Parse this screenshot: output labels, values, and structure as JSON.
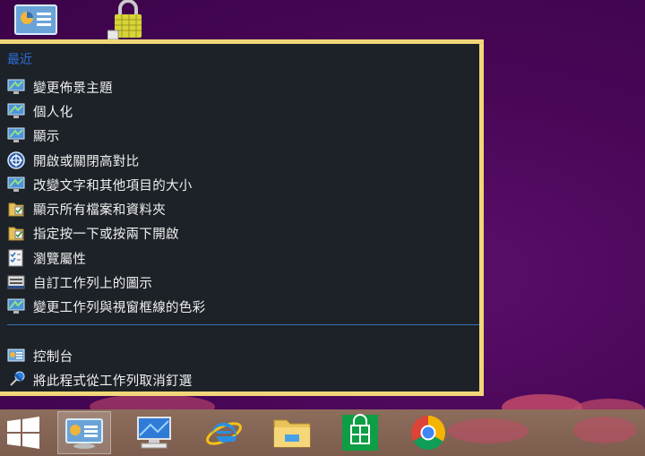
{
  "jumplist": {
    "recent_header": "最近",
    "recent_items": [
      {
        "label": "變更佈景主題",
        "icon": "monitor-icon"
      },
      {
        "label": "個人化",
        "icon": "monitor-icon"
      },
      {
        "label": "顯示",
        "icon": "monitor-icon"
      },
      {
        "label": "開啟或關閉高對比",
        "icon": "accessibility-icon"
      },
      {
        "label": "改變文字和其他項目的大小",
        "icon": "monitor-icon"
      },
      {
        "label": "顯示所有檔案和資料夾",
        "icon": "folder-options-icon"
      },
      {
        "label": "指定按一下或按兩下開啟",
        "icon": "folder-options-icon"
      },
      {
        "label": "瀏覽屬性",
        "icon": "checklist-icon"
      },
      {
        "label": "自訂工作列上的圖示",
        "icon": "taskbar-icon"
      },
      {
        "label": "變更工作列與視窗框線的色彩",
        "icon": "monitor-icon"
      }
    ],
    "tasks": [
      {
        "label": "控制台",
        "icon": "control-panel-icon"
      },
      {
        "label": "將此程式從工作列取消釘選",
        "icon": "unpin-icon"
      }
    ]
  },
  "taskbar": {
    "buttons": [
      {
        "name": "start-button",
        "icon": "windows-logo-icon"
      },
      {
        "name": "control-panel-taskbar-button",
        "icon": "control-panel-icon",
        "active": true
      },
      {
        "name": "computer-taskbar-button",
        "icon": "computer-icon"
      },
      {
        "name": "internet-explorer-taskbar-button",
        "icon": "internet-explorer-icon"
      },
      {
        "name": "file-explorer-taskbar-button",
        "icon": "folder-icon"
      },
      {
        "name": "store-taskbar-button",
        "icon": "store-icon"
      },
      {
        "name": "chrome-taskbar-button",
        "icon": "chrome-icon"
      }
    ]
  },
  "desktop_icons": [
    {
      "name": "control-panel-desktop-icon",
      "icon": "control-panel-icon"
    },
    {
      "name": "lock-folder-desktop-icon",
      "icon": "padlock-icon"
    }
  ],
  "colors": {
    "desktop_bg": "#4a0758",
    "jumplist_bg": "#1d2228",
    "jumplist_border": "#f2d67a",
    "header_text": "#2c6fd6",
    "item_text": "#f0f0f0"
  }
}
